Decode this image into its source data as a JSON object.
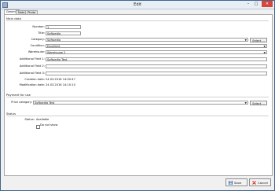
{
  "window": {
    "title": "Edit"
  },
  "titlebar": {
    "minimize": "–",
    "maximize": "□",
    "close": "✕"
  },
  "tabs": [
    {
      "label": "General"
    },
    {
      "label": "Note"
    },
    {
      "label": "Photo"
    }
  ],
  "main_data": {
    "section_label": "Main data",
    "number_label": "Number:",
    "number_value": "1",
    "title_label": "Title:",
    "title_value": "Softpedia",
    "category_label": "Category:",
    "category_value": "Softpedia",
    "category_select": "Select ...",
    "condition_label": "Condition:",
    "condition_value": "Excellent",
    "warehouse_label": "Warehouse:",
    "warehouse_value": "Warehouse 2",
    "af1_label": "Additional Field 1:",
    "af1_value": "Softpedia Test",
    "af2_label": "Additional Field 2:",
    "af2_value": "",
    "af3_label": "Additional Field 3:",
    "af3_value": "",
    "creation_label": "Creation date:",
    "creation_value": "24.03.2016  14:00:47",
    "modification_label": "Modification date:",
    "modification_value": "24.03.2016  14:10:10"
  },
  "payment": {
    "section_label": "Payment for use",
    "price_label": "Price category:",
    "price_value": "Softpedia Test",
    "price_select": "Select ..."
  },
  "status": {
    "section_label": "Status",
    "status_label": "Status:",
    "status_value": "Available",
    "do_not_show_label": "Do not show"
  },
  "footer": {
    "save_label": "Save",
    "cancel_label": "Cancel"
  }
}
